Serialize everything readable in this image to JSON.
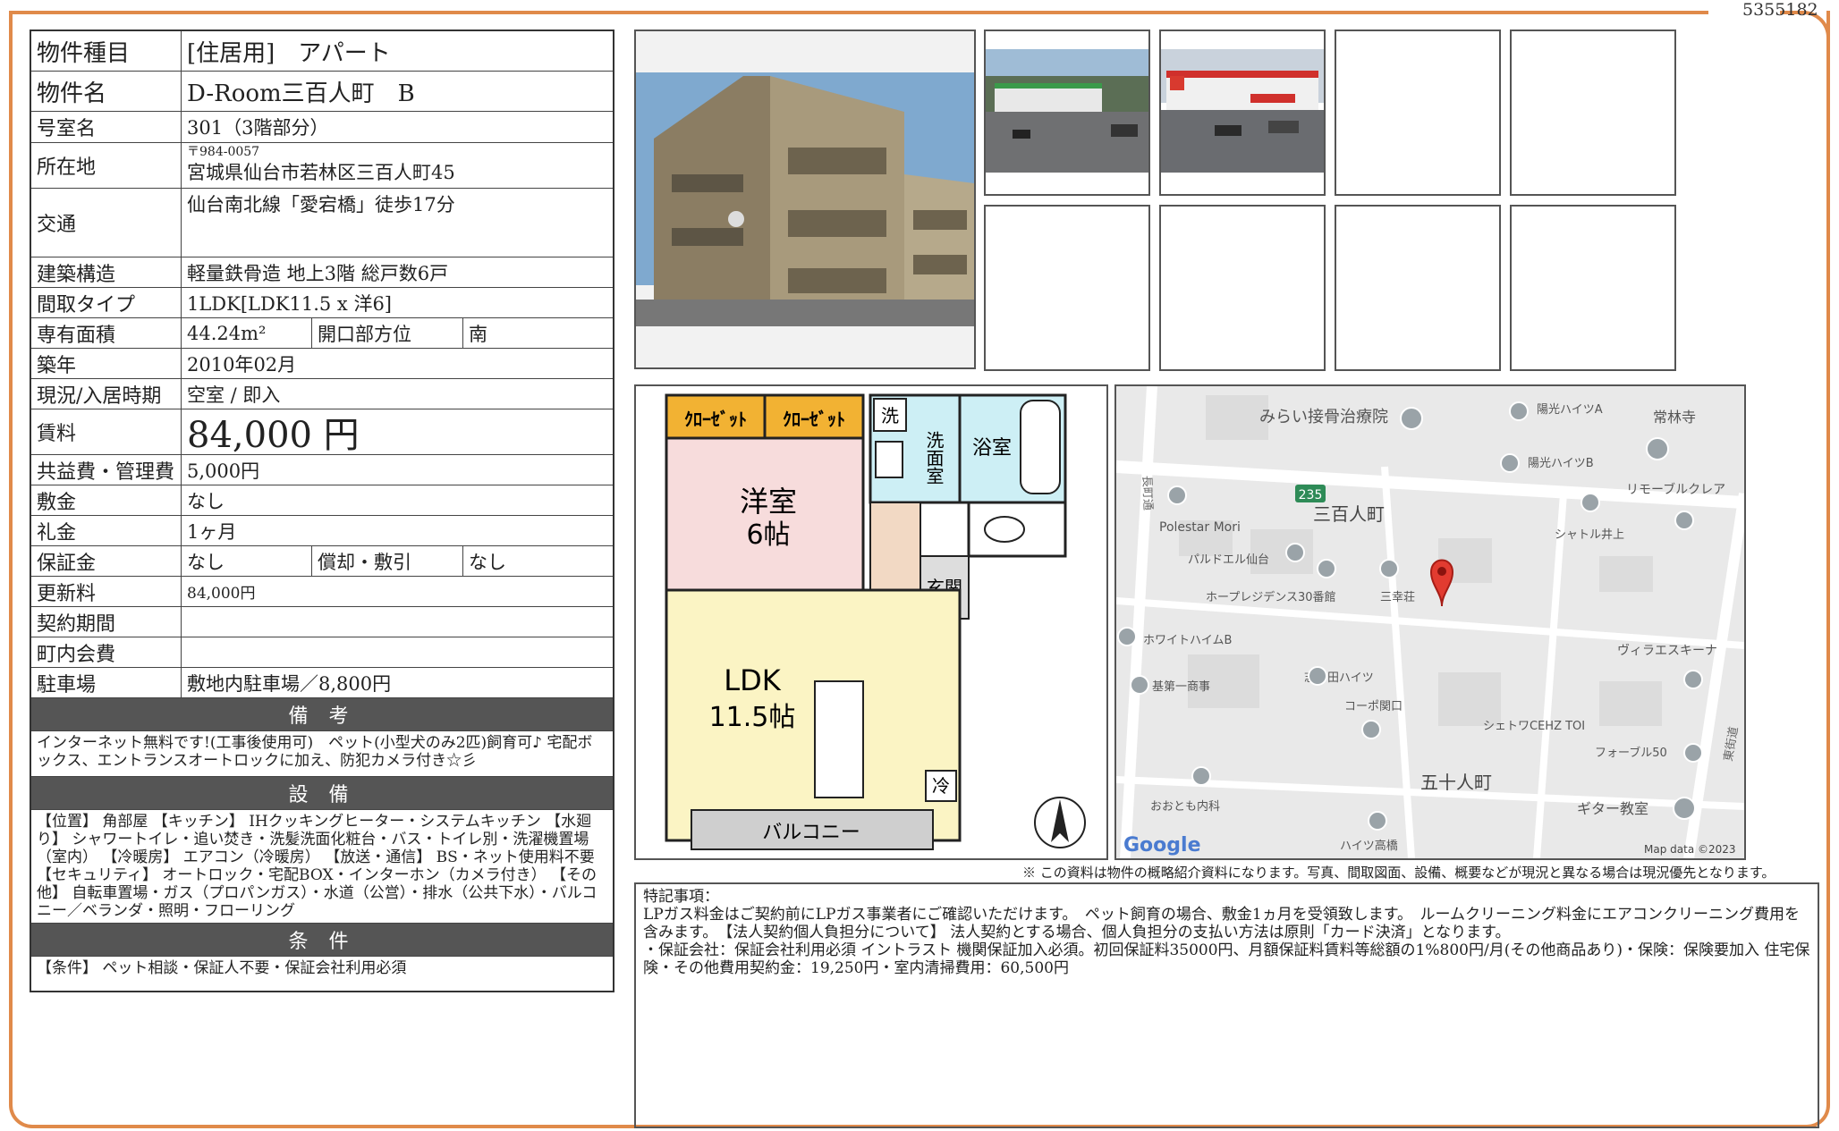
{
  "doc_id": "5355182",
  "info": {
    "property_type": {
      "label": "物件種目",
      "value": "[住居用]　アパート"
    },
    "property_name": {
      "label": "物件名",
      "value": "D-Room三百人町　B"
    },
    "room": {
      "label": "号室名",
      "value": "301（3階部分）"
    },
    "address": {
      "label": "所在地",
      "postal": "〒984-0057",
      "value": "宮城県仙台市若林区三百人町45"
    },
    "transport": {
      "label": "交通",
      "value": "仙台南北線「愛宕橋」徒歩17分"
    },
    "structure": {
      "label": "建築構造",
      "value": "軽量鉄骨造 地上3階 総戸数6戸"
    },
    "layout": {
      "label": "間取タイプ",
      "value": "1LDK[LDK11.5 x 洋6]"
    },
    "area": {
      "label": "専有面積",
      "value": "44.24m²",
      "sub_label": "開口部方位",
      "sub_value": "南"
    },
    "built": {
      "label": "築年",
      "value": "2010年02月"
    },
    "status": {
      "label": "現況/入居時期",
      "value": "空室 / 即入"
    },
    "rent": {
      "label": "賃料",
      "value": "84,000 円"
    },
    "common_fee": {
      "label": "共益費・管理費",
      "value": "5,000円"
    },
    "deposit": {
      "label": "敷金",
      "value": "なし"
    },
    "key_money": {
      "label": "礼金",
      "value": "1ヶ月"
    },
    "guarantee": {
      "label": "保証金",
      "value": "なし",
      "sub_label": "償却・敷引",
      "sub_value": "なし"
    },
    "renewal": {
      "label": "更新料",
      "value": "84,000円"
    },
    "contract_period": {
      "label": "契約期間",
      "value": ""
    },
    "community_fee": {
      "label": "町内会費",
      "value": ""
    },
    "parking": {
      "label": "駐車場",
      "value": "敷地内駐車場／8,800円"
    }
  },
  "sections": {
    "remarks_title": "備 考",
    "remarks_text": "インターネット無料です!(工事後使用可)　ペット(小型犬のみ2匹)飼育可♪ 宅配ボックス、エントランスオートロックに加え、防犯カメラ付き☆彡",
    "equipment_title": "設 備",
    "equipment_text": "【位置】 角部屋 【キッチン】 IHクッキングヒーター・システムキッチン 【水廻り】 シャワートイレ・追い焚き・洗髪洗面化粧台・バス・トイレ別・洗濯機置場（室内） 【冷暖房】 エアコン（冷暖房） 【放送・通信】 BS・ネット使用料不要 【セキュリティ】 オートロック・宅配BOX・インターホン（カメラ付き） 【その他】 自転車置場・ガス（プロパンガス）・水道（公営）・排水（公共下水）・バルコニー／ベランダ・照明・フローリング",
    "conditions_title": "条 件",
    "conditions_text": "【条件】 ペット相談・保証人不要・保証会社利用必須"
  },
  "floorplan": {
    "closet1": "ｸﾛｰｾﾞｯﾄ",
    "closet2": "ｸﾛｰｾﾞｯﾄ",
    "wash_small": "洗",
    "washroom": "洗面室",
    "bath": "浴室",
    "western_room": "洋室",
    "western_size": "6帖",
    "entrance": "玄関",
    "ldk": "LDK",
    "ldk_size": "11.5帖",
    "fridge": "冷",
    "balcony": "バルコニー"
  },
  "map": {
    "labels": {
      "clinic": "みらい接骨治療院",
      "yoko_a": "陽光ハイツA",
      "jorinji": "常林寺",
      "yoko_b": "陽光ハイツB",
      "remove": "リモーブルクレア",
      "route": "235",
      "sanbyaku": "三百人町",
      "polestar": "Polestar Mori",
      "shuttle": "シャトル井上",
      "pal": "パルドエル仙台",
      "hope": "ホープレジデンス30番館",
      "sanko": "三幸荘",
      "white": "ホワイトハイムB",
      "villa": "ヴィラエスキーナ",
      "kiso": "基第一商事",
      "shikoda": "志子田ハイツ",
      "koposeki": "コーポ関口",
      "shetowa": "シェトワCEHZ TOI",
      "fable": "フォーブル50",
      "gojunin": "五十人町",
      "otomo": "おおとも内科",
      "guitar": "ギター教室",
      "haitsu_taka": "ハイツ高橋",
      "nagamachi": "長町通",
      "higashi": "東街道",
      "google": "Google",
      "mapdata": "Map data ©2023"
    }
  },
  "disclaimer": "※ この資料は物件の概略紹介資料になります。写真、間取図面、設備、概要などが現況と異なる場合は現況優先となります。",
  "special_notes": {
    "title": "特記事項：",
    "line1": "LPガス料金はご契約前にLPガス事業者にご確認いただけます。　ペット飼育の場合、敷金1ヵ月を受領致します。　ルームクリーニング料金にエアコンクリーニング費用を含みます。　【法人契約個人負担分について】 法人契約とする場合、個人負担分の支払い方法は原則「カード決済」となります。",
    "line2": "・保証会社：保証会社利用必須 イントラスト 機関保証加入必須。初回保証料35000円、月額保証料賃料等総額の1%800円/月(その他商品あり)・保険：保険要加入 住宅保険・その他費用契約金：19,250円・室内清掃費用：60,500円"
  }
}
